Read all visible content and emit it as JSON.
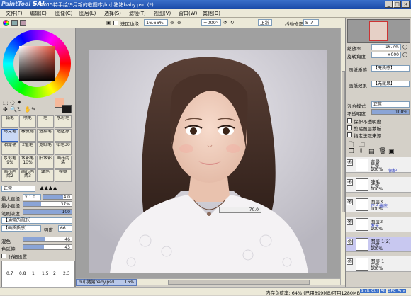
{
  "window": {
    "logo_pre": "PaintTool",
    "logo": "SAI",
    "title": "E:\\2015特手绘\\9月新的收图本\\hi小猪猪baby.psd (*)",
    "min": "_",
    "max": "□",
    "close": "×"
  },
  "menu": [
    "文件(F)",
    "编辑(E)",
    "图像(C)",
    "图层(L)",
    "选择(S)",
    "滤镜(T)",
    "视图(V)",
    "窗口(W)",
    "其他(O)"
  ],
  "toolbar": {
    "selection_edge": "选区边缘",
    "zoom": "16.66%",
    "angle": "+000°",
    "mode": "正常",
    "stabilizer_label": "抖动修正",
    "stabilizer": "S-7"
  },
  "left": {
    "tools_row1": [
      "铅笔",
      "喷笔",
      "笔",
      "水彩笔"
    ],
    "tools_row2": [
      "马克笔",
      "橡皮擦",
      "选择笔",
      "选区擦"
    ],
    "tools_row3": [
      "油漆桶",
      "2值笔",
      "宽纸笔",
      "铅笔30"
    ],
    "tools_row4": [
      "水彩笔9%",
      "水彩笔10%",
      "旧水彩",
      "画布丙烯"
    ],
    "tools_row5": [
      "画布丙烯2",
      "画布丙烯3",
      "蜡笔",
      "模糊"
    ],
    "mode": "正常",
    "max_size_label": "最大直径",
    "max_size_mult": "x 1.0",
    "max_size_value": "14.0",
    "min_size_label": "最小直径",
    "min_size_value": "37%",
    "min_size_level": 0.37,
    "density_label": "笔刷浓度",
    "density_value": "100",
    "density_level": 1.0,
    "shape_label": "【通常的圆形】",
    "texture_label": "【画质质感】",
    "strength_label": "强度",
    "strength_value": "66",
    "blend_label": "混色",
    "blend_value": "46",
    "blend_level": 0.46,
    "dilution_label": "色延伸",
    "dilution_value": "43",
    "dilution_level": 0.43,
    "detail_label": "详细设置",
    "sizes": [
      "0.7",
      "0.8",
      "1",
      "1.5",
      "2",
      "2.3"
    ],
    "primary_color": "#f5b89a",
    "secondary_color": "#1a1a1a"
  },
  "canvas": {
    "overlay_value": "70.0",
    "doc_tab": "hi小猪猪baby.psd",
    "doc_zoom": "16%"
  },
  "right": {
    "nav_zoom_label": "缩放率",
    "nav_zoom": "16.7%",
    "nav_angle_label": "旋转角度",
    "nav_angle": "+000",
    "texture_label": "画纸质感",
    "texture_value": "【无质感】",
    "effect_label": "画纸效果",
    "effect_value": "【无效果】",
    "mix_mode_label": "混合模式",
    "mix_mode_value": "正常",
    "opacity_label": "不透明度",
    "opacity_value": "100%",
    "opacity_level": 1.0,
    "check1": "保护不透明度",
    "check2": "剪贴图层蒙板",
    "check3": "指定选取来源"
  },
  "layers": [
    {
      "name": "背景",
      "mode": "正常",
      "opacity": "100%",
      "extra": "保护"
    },
    {
      "name": "睫毛",
      "mode": "正常",
      "opacity": "100%",
      "extra": ""
    },
    {
      "name": "图层3",
      "mode": "正片叠底",
      "opacity": "100%",
      "extra": ""
    },
    {
      "name": "图层2",
      "mode": "发光",
      "opacity": "100%",
      "extra": ""
    },
    {
      "name": "图层 1(2)",
      "mode": "正常",
      "opacity": "100%",
      "extra": ""
    },
    {
      "name": "图层 1",
      "mode": "正常",
      "opacity": "100%",
      "extra": ""
    }
  ],
  "status": {
    "memory": "内存负荷率: 64% (已用899MB/可用1280MB)",
    "keys": [
      "Shift",
      "Ctrl",
      "Alt",
      "SPC",
      "Any"
    ]
  }
}
